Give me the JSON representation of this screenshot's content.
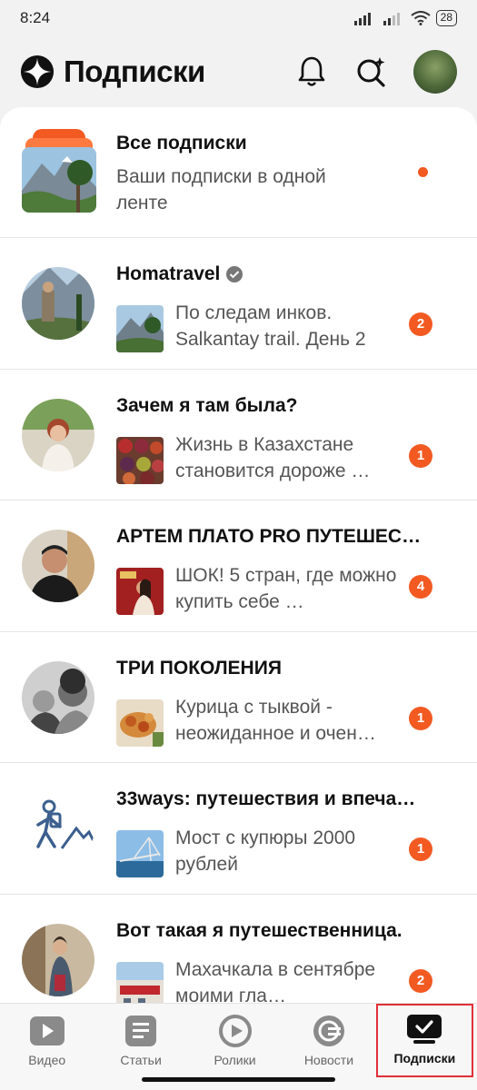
{
  "status_bar": {
    "time": "8:24",
    "battery": "28"
  },
  "header": {
    "title": "Подписки"
  },
  "all_subscriptions": {
    "title": "Все подписки",
    "subtitle": "Ваши подписки в одной ленте"
  },
  "channels": [
    {
      "title": "Homatravel",
      "verified": true,
      "subtitle": "По следам инков. Salkantay trail. День 2",
      "badge": "2"
    },
    {
      "title": "Зачем я там была?",
      "verified": false,
      "subtitle": "Жизнь в Казахстане становится дороже …",
      "badge": "1"
    },
    {
      "title": "АРТЕМ ПЛАТО PRO ПУТЕШЕС…",
      "verified": false,
      "subtitle": "ШОК! 5 стран, где можно купить себе …",
      "badge": "4"
    },
    {
      "title": "ТРИ ПОКОЛЕНИЯ",
      "verified": false,
      "subtitle": "Курица с тыквой - неожиданное и очен…",
      "badge": "1"
    },
    {
      "title": "33ways: путешествия и впеча…",
      "verified": false,
      "subtitle": "Мост с купюры 2000 рублей",
      "badge": "1"
    },
    {
      "title": "Вот такая я путешественница.",
      "verified": false,
      "subtitle": "Махачкала в сентябре моими гла…",
      "badge": "2"
    }
  ],
  "bottom_nav": [
    {
      "label": "Видео",
      "icon": "video-icon"
    },
    {
      "label": "Статьи",
      "icon": "articles-icon"
    },
    {
      "label": "Ролики",
      "icon": "clips-icon"
    },
    {
      "label": "Новости",
      "icon": "news-icon"
    },
    {
      "label": "Подписки",
      "icon": "subscriptions-icon",
      "active": true
    }
  ],
  "colors": {
    "accent": "#f25a22",
    "highlight_border": "#e0303a"
  }
}
